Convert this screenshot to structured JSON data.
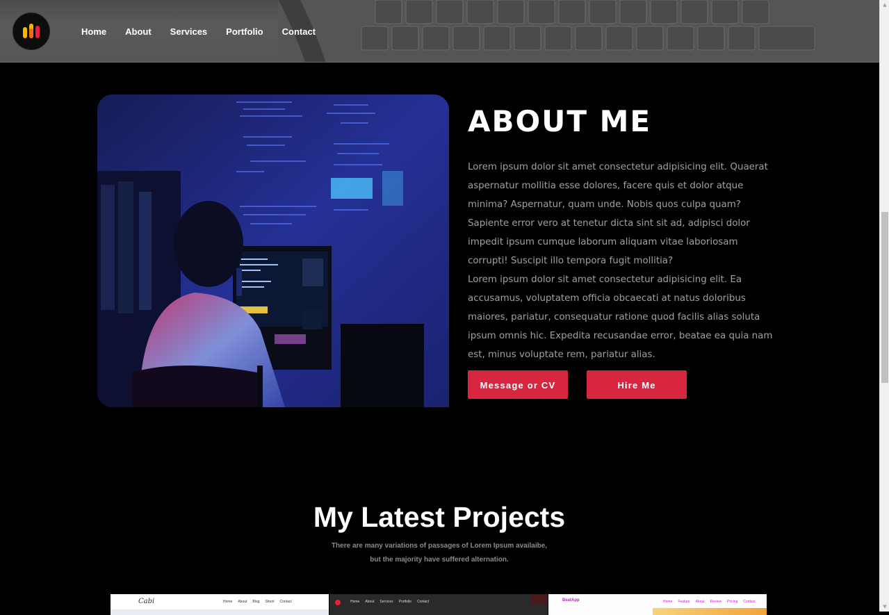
{
  "nav": {
    "items": [
      {
        "label": "Home"
      },
      {
        "label": "About"
      },
      {
        "label": "Services"
      },
      {
        "label": "Portfolio"
      },
      {
        "label": "Contact"
      }
    ]
  },
  "about": {
    "title": "ABOUT ME",
    "paragraph1": "Lorem ipsum dolor sit amet consectetur adipisicing elit. Quaerat aspernatur mollitia esse dolores, facere quis et dolor atque minima? Aspernatur, quam unde. Nobis quos culpa quam? Sapiente error vero at tenetur dicta sint sit ad, adipisci dolor impedit ipsum cumque laborum aliquam vitae laboriosam corrupti! Suscipit illo tempora fugit mollitia?",
    "paragraph2": "Lorem ipsum dolor sit amet consectetur adipisicing elit. Ea accusamus, voluptatem officia obcaecati at natus doloribus maiores, pariatur, consequatur ratione quod facilis alias soluta ipsum omnis hic. Expedita recusandae error, beatae ea quia nam est, minus voluptate rem, pariatur alias.",
    "button_cv": "Message or CV",
    "button_hire": "Hire Me"
  },
  "projects": {
    "title": "My Latest Projects",
    "subtitle_line1": "There are many variations of passages of Lorem Ipsum availaibe,",
    "subtitle_line2": "but the majority have suffered alternation.",
    "thumbs": [
      {
        "brand": "Cabi",
        "nav": [
          "Home",
          "About",
          "Blog",
          "Shoot",
          "Contact"
        ]
      },
      {
        "brand": "",
        "nav": [
          "Home",
          "About",
          "Services",
          "Portfolio",
          "Contact"
        ]
      },
      {
        "brand": "BeatApp",
        "nav": [
          "Home",
          "Feature",
          "About",
          "Review",
          "Pricing",
          "Contact"
        ]
      }
    ]
  },
  "colors": {
    "accent": "#d7263d",
    "background": "#000000",
    "text_muted": "#a0a0a0"
  },
  "icons": {
    "logo": "brand-logo-icon"
  }
}
